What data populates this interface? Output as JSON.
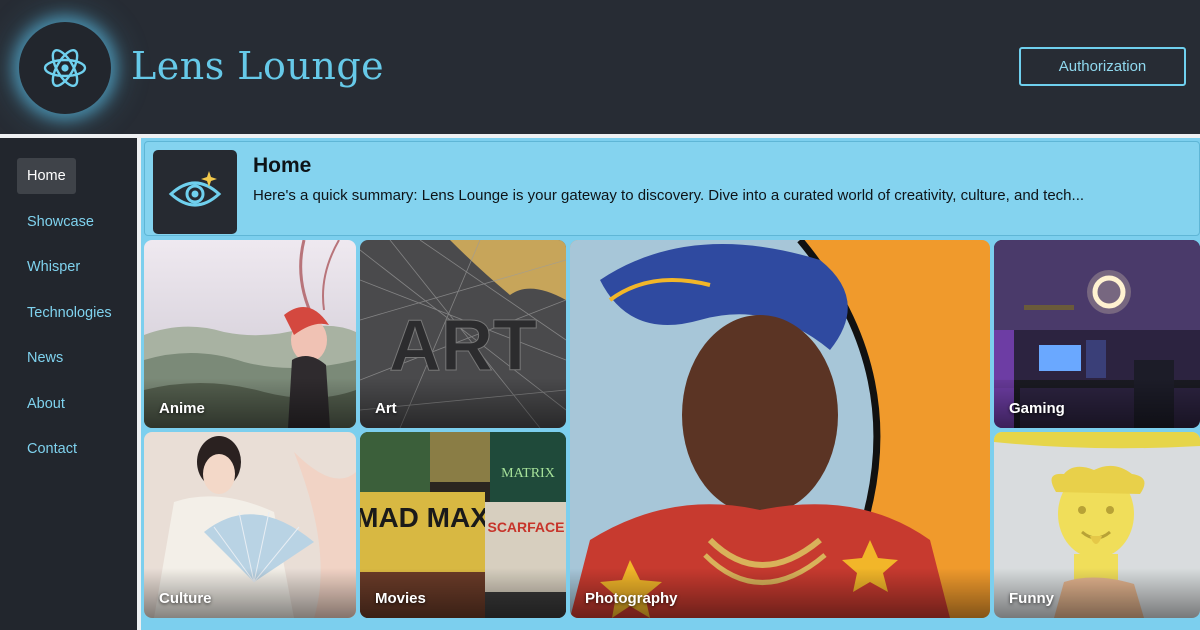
{
  "header": {
    "logo_icon": "atom-icon",
    "brand": "Lens Lounge",
    "auth_label": "Authorization"
  },
  "sidebar": {
    "items": [
      {
        "label": "Home",
        "active": true
      },
      {
        "label": "Showcase",
        "active": false
      },
      {
        "label": "Whisper",
        "active": false
      },
      {
        "label": "Technologies",
        "active": false
      },
      {
        "label": "News",
        "active": false
      },
      {
        "label": "About",
        "active": false
      },
      {
        "label": "Contact",
        "active": false
      }
    ]
  },
  "page": {
    "icon": "eye-sparkle-icon",
    "title": "Home",
    "summary": "Here's a quick summary: Lens Lounge is your gateway to discovery. Dive into a curated world of creativity, culture, and tech..."
  },
  "categories": {
    "anime": "Anime",
    "art": "Art",
    "culture": "Culture",
    "movies": "Movies",
    "photography": "Photography",
    "gaming": "Gaming",
    "funny": "Funny"
  },
  "colors": {
    "header_bg": "#272c34",
    "accent": "#66c9e8",
    "main_bg": "#7ccfee",
    "sidebar_bg": "#22262d"
  }
}
